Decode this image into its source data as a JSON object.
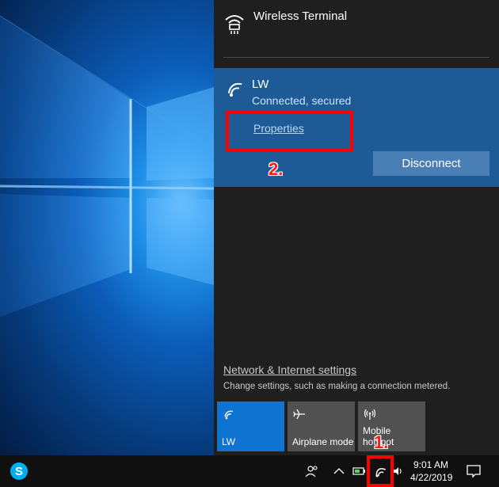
{
  "networks": {
    "other": {
      "name": "Wireless Terminal",
      "icon": "wifi-secured-icon"
    },
    "connected": {
      "name": "LW",
      "status": "Connected, secured",
      "icon": "wifi-icon",
      "properties_label": "Properties",
      "disconnect_label": "Disconnect"
    }
  },
  "settings": {
    "link_label": "Network & Internet settings",
    "description": "Change settings, such as making a connection metered."
  },
  "quick_actions": [
    {
      "label": "LW",
      "icon": "wifi-icon",
      "active": true
    },
    {
      "label": "Airplane mode",
      "icon": "airplane-icon",
      "active": false
    },
    {
      "label": "Mobile\nhotspot",
      "icon": "hotspot-icon",
      "active": false
    }
  ],
  "annotations": {
    "step1": "1.",
    "step2": "2."
  },
  "taskbar": {
    "time": "9:01 AM",
    "date": "4/22/2019",
    "app_icon": "skype-icon"
  },
  "colors": {
    "accent": "#0f73d1",
    "selected_bg": "#1d5a96",
    "flyout_bg": "#1f1f1f",
    "annotation": "#ff0000"
  }
}
